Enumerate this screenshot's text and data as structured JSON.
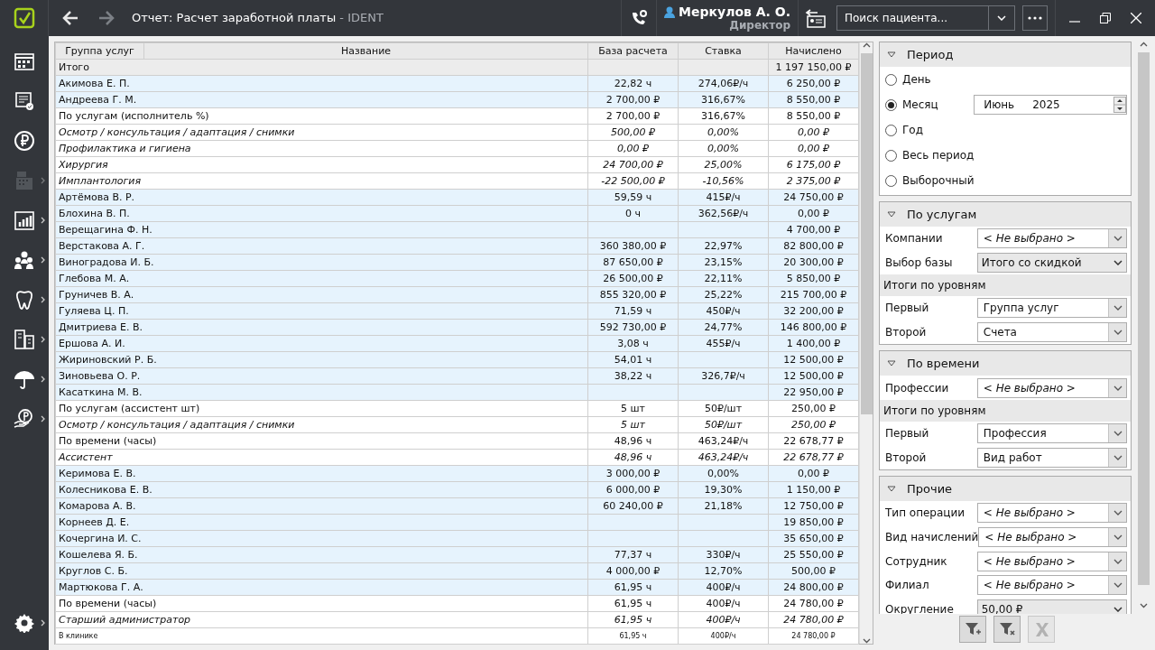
{
  "window": {
    "title": "Отчет: Расчет заработной платы",
    "app": "- IDENT"
  },
  "nav": {
    "back_enabled": true,
    "forward_enabled": false
  },
  "user": {
    "name": "Меркулов А. О.",
    "role": "Директор"
  },
  "search": {
    "placeholder": "Поиск пациента..."
  },
  "sidebar": {
    "items": [
      {
        "submenu": false,
        "disabled": false
      },
      {
        "submenu": false,
        "disabled": false
      },
      {
        "submenu": false,
        "disabled": false
      },
      {
        "submenu": true,
        "disabled": true
      },
      {
        "submenu": true,
        "disabled": false
      },
      {
        "submenu": true,
        "disabled": false
      },
      {
        "submenu": true,
        "disabled": false
      },
      {
        "submenu": true,
        "disabled": false
      },
      {
        "submenu": true,
        "disabled": false
      },
      {
        "submenu": true,
        "disabled": false
      }
    ],
    "settings": {
      "submenu": true
    }
  },
  "table": {
    "columns": [
      "Группа услуг",
      "Название",
      "База расчета",
      "Ставка",
      "Начислено"
    ],
    "rows": [
      {
        "kind": "total",
        "name": "Итого",
        "amount": "1 197 150,00 ₽"
      },
      {
        "kind": "person",
        "name": "Акимова Е. П.",
        "base": "22,82 ч",
        "rate": "274,06₽/ч",
        "amount": "6 250,00 ₽"
      },
      {
        "kind": "person",
        "name": "Андреева Г. М.",
        "base": "2 700,00 ₽",
        "rate": "316,67%",
        "amount": "8 550,00 ₽"
      },
      {
        "kind": "group",
        "name": "По услугам (исполнитель %)",
        "base": "2 700,00 ₽",
        "rate": "316,67%",
        "amount": "8 550,00 ₽"
      },
      {
        "kind": "item",
        "name": "Осмотр / консультация / адаптация / снимки",
        "base": "500,00 ₽",
        "rate": "0,00%",
        "amount": "0,00 ₽"
      },
      {
        "kind": "item",
        "name": "Профилактика и гигиена",
        "base": "0,00 ₽",
        "rate": "0,00%",
        "amount": "0,00 ₽"
      },
      {
        "kind": "item",
        "name": "Хирургия",
        "base": "24 700,00 ₽",
        "rate": "25,00%",
        "amount": "6 175,00 ₽"
      },
      {
        "kind": "item",
        "name": "Имплантология",
        "base": "-22 500,00 ₽",
        "rate": "-10,56%",
        "amount": "2 375,00 ₽"
      },
      {
        "kind": "person",
        "name": "Артёмова В. Р.",
        "base": "59,59 ч",
        "rate": "415₽/ч",
        "amount": "24 750,00 ₽"
      },
      {
        "kind": "person",
        "name": "Блохина В. П.",
        "base": "0 ч",
        "rate": "362,56₽/ч",
        "amount": "0,00 ₽"
      },
      {
        "kind": "person",
        "name": "Верещагина Ф. Н.",
        "amount": "4 700,00 ₽"
      },
      {
        "kind": "person",
        "name": "Верстакова А. Г.",
        "base": "360 380,00 ₽",
        "rate": "22,97%",
        "amount": "82 800,00 ₽"
      },
      {
        "kind": "person",
        "name": "Виноградова И. Б.",
        "base": "87 650,00 ₽",
        "rate": "23,15%",
        "amount": "20 300,00 ₽"
      },
      {
        "kind": "person",
        "name": "Глебова М. А.",
        "base": "26 500,00 ₽",
        "rate": "22,11%",
        "amount": "5 850,00 ₽"
      },
      {
        "kind": "person",
        "name": "Груничев В. А.",
        "base": "855 320,00 ₽",
        "rate": "25,22%",
        "amount": "215 700,00 ₽"
      },
      {
        "kind": "person",
        "name": "Гуляева Ц. П.",
        "base": "71,59 ч",
        "rate": "450₽/ч",
        "amount": "32 200,00 ₽"
      },
      {
        "kind": "person",
        "name": "Дмитриева Е. В.",
        "base": "592 730,00 ₽",
        "rate": "24,77%",
        "amount": "146 800,00 ₽"
      },
      {
        "kind": "person",
        "name": "Ершова А. И.",
        "base": "3,08 ч",
        "rate": "455₽/ч",
        "amount": "1 400,00 ₽"
      },
      {
        "kind": "person",
        "name": "Жириновский Р. Б.",
        "base": "54,01 ч",
        "amount": "12 500,00 ₽"
      },
      {
        "kind": "person",
        "name": "Зиновьева О. Р.",
        "base": "38,22 ч",
        "rate": "326,7₽/ч",
        "amount": "12 500,00 ₽"
      },
      {
        "kind": "person",
        "name": "Касаткина М. В.",
        "amount": "22 950,00 ₽"
      },
      {
        "kind": "group",
        "name": "По услугам (ассистент шт)",
        "base": "5 шт",
        "rate": "50₽/шт",
        "amount": "250,00 ₽"
      },
      {
        "kind": "item",
        "name": "Осмотр / консультация / адаптация / снимки",
        "base": "5 шт",
        "rate": "50₽/шт",
        "amount": "250,00 ₽"
      },
      {
        "kind": "group",
        "name": "По времени (часы)",
        "base": "48,96 ч",
        "rate": "463,24₽/ч",
        "amount": "22 678,77 ₽"
      },
      {
        "kind": "item",
        "name": "Ассистент",
        "base": "48,96 ч",
        "rate": "463,24₽/ч",
        "amount": "22 678,77 ₽"
      },
      {
        "kind": "person",
        "name": "Керимова Е. В.",
        "base": "3 000,00 ₽",
        "rate": "0,00%",
        "amount": "0,00 ₽"
      },
      {
        "kind": "person",
        "name": "Колесникова Е. В.",
        "base": "6 000,00 ₽",
        "rate": "19,30%",
        "amount": "1 150,00 ₽"
      },
      {
        "kind": "person",
        "name": "Комарова А. В.",
        "base": "60 240,00 ₽",
        "rate": "21,18%",
        "amount": "12 750,00 ₽"
      },
      {
        "kind": "person",
        "name": "Корнеев Д. Е.",
        "amount": "19 850,00 ₽"
      },
      {
        "kind": "person",
        "name": "Кочергина И. С.",
        "amount": "35 650,00 ₽"
      },
      {
        "kind": "person",
        "name": "Кошелева Я. Б.",
        "base": "77,37 ч",
        "rate": "330₽/ч",
        "amount": "25 550,00 ₽"
      },
      {
        "kind": "person",
        "name": "Круглов С. Б.",
        "base": "4 000,00 ₽",
        "rate": "12,70%",
        "amount": "500,00 ₽"
      },
      {
        "kind": "person",
        "name": "Мартюкова Г. А.",
        "base": "61,95 ч",
        "rate": "400₽/ч",
        "amount": "24 800,00 ₽"
      },
      {
        "kind": "group",
        "name": "По времени (часы)",
        "base": "61,95 ч",
        "rate": "400₽/ч",
        "amount": "24 780,00 ₽"
      },
      {
        "kind": "item",
        "name": "Старший администратор",
        "base": "61,95 ч",
        "rate": "400₽/ч",
        "amount": "24 780,00 ₽"
      },
      {
        "kind": "small",
        "name": "В клинике",
        "base": "61,95 ч",
        "rate": "400₽/ч",
        "amount": "24 780,00 ₽"
      }
    ]
  },
  "filters": {
    "sections": [
      {
        "title": "Период",
        "expanded": true,
        "items": [
          {
            "kind": "radio",
            "label": "День",
            "selected": false
          },
          {
            "kind": "radio",
            "label": "Месяц",
            "selected": true,
            "month": "Июнь",
            "year": "2025"
          },
          {
            "kind": "radio",
            "label": "Год",
            "selected": false
          },
          {
            "kind": "radio",
            "label": "Весь период",
            "selected": false
          },
          {
            "kind": "radio",
            "label": "Выборочный",
            "selected": false
          }
        ]
      },
      {
        "title": "По услугам",
        "expanded": true,
        "items": [
          {
            "kind": "combo",
            "label": "Компании",
            "value": "< Не выбрано >",
            "unset": true
          },
          {
            "kind": "select",
            "label": "Выбор базы",
            "value": "Итого со скидкой",
            "unset": false
          },
          {
            "kind": "subheader",
            "label": "Итоги по уровням"
          },
          {
            "kind": "combo",
            "label": "Первый",
            "value": "Группа услуг",
            "unset": false
          },
          {
            "kind": "combo",
            "label": "Второй",
            "value": "Счета",
            "unset": false
          }
        ]
      },
      {
        "title": "По времени",
        "expanded": true,
        "items": [
          {
            "kind": "combo",
            "label": "Профессии",
            "value": "< Не выбрано >",
            "unset": true
          },
          {
            "kind": "subheader",
            "label": "Итоги по уровням"
          },
          {
            "kind": "combo",
            "label": "Первый",
            "value": "Профессия",
            "unset": false
          },
          {
            "kind": "combo",
            "label": "Второй",
            "value": "Вид работ",
            "unset": false
          }
        ]
      },
      {
        "title": "Прочие",
        "expanded": true,
        "items": [
          {
            "kind": "combo",
            "label": "Тип операции",
            "value": "< Не выбрано >",
            "unset": true
          },
          {
            "kind": "combo",
            "label": "Вид начислений",
            "value": "< Не выбрано >",
            "unset": true
          },
          {
            "kind": "combo",
            "label": "Сотрудник",
            "value": "< Не выбрано >",
            "unset": true
          },
          {
            "kind": "combo",
            "label": "Филиал",
            "value": "< Не выбрано >",
            "unset": true
          },
          {
            "kind": "select",
            "label": "Округление",
            "value": "50,00 ₽",
            "unset": false
          }
        ]
      }
    ],
    "buttons": [
      {
        "kind": "apply",
        "disabled": false
      },
      {
        "kind": "clear",
        "disabled": false
      },
      {
        "kind": "reset",
        "disabled": true
      }
    ]
  }
}
